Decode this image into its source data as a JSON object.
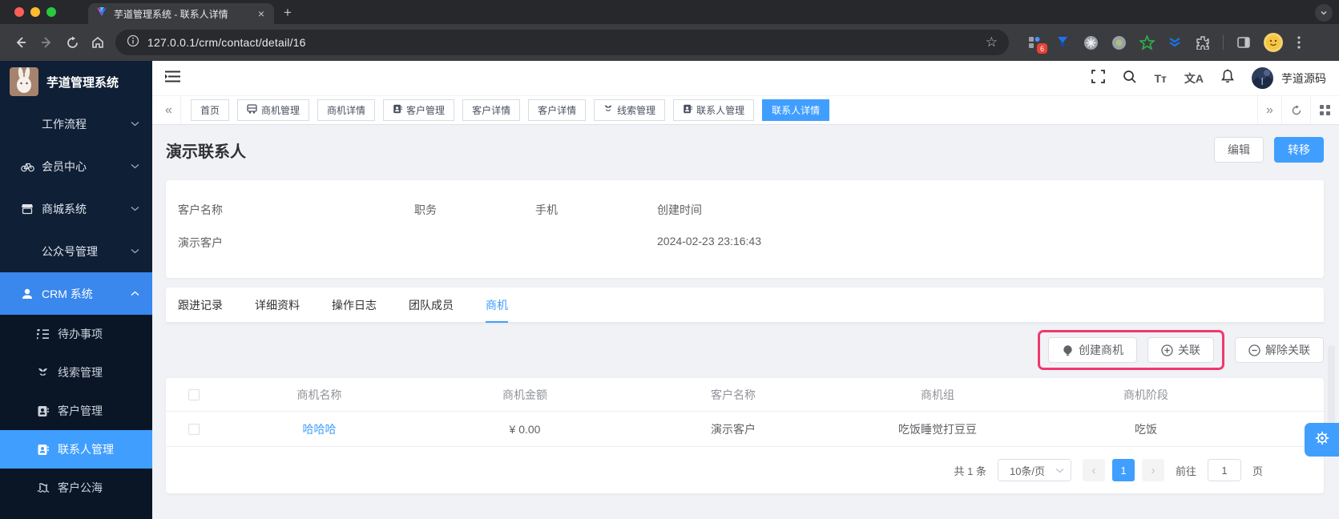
{
  "browser": {
    "tab_title": "芋道管理系统 - 联系人详情",
    "close_tab": "×",
    "new_tab": "+",
    "url": "127.0.0.1/crm/contact/detail/16",
    "bookmark_star": "☆",
    "extension_badge": "6"
  },
  "sidebar": {
    "app_title": "芋道管理系统",
    "root_items": [
      {
        "label": "工作流程"
      },
      {
        "label": "会员中心"
      },
      {
        "label": "商城系统"
      },
      {
        "label": "公众号管理"
      },
      {
        "label": "CRM 系统"
      }
    ],
    "crm_children": [
      {
        "label": "待办事项"
      },
      {
        "label": "线索管理"
      },
      {
        "label": "客户管理"
      },
      {
        "label": "联系人管理"
      },
      {
        "label": "客户公海"
      }
    ]
  },
  "header": {
    "font_icon": "Tт",
    "lang_icon": "文A",
    "username": "芋道源码"
  },
  "tags": {
    "back_arrow": "«",
    "forward_arrow": "»",
    "items": [
      {
        "label": "首页"
      },
      {
        "label": "商机管理"
      },
      {
        "label": "商机详情"
      },
      {
        "label": "客户管理"
      },
      {
        "label": "客户详情"
      },
      {
        "label": "客户详情"
      },
      {
        "label": "线索管理"
      },
      {
        "label": "联系人管理"
      },
      {
        "label": "联系人详情"
      }
    ]
  },
  "page": {
    "title": "演示联系人",
    "edit_label": "编辑",
    "transfer_label": "转移",
    "info": {
      "fields": [
        {
          "label": "客户名称",
          "value": "演示客户"
        },
        {
          "label": "职务",
          "value": ""
        },
        {
          "label": "手机",
          "value": ""
        },
        {
          "label": "创建时间",
          "value": "2024-02-23 23:16:43"
        }
      ]
    },
    "tabs": [
      {
        "label": "跟进记录"
      },
      {
        "label": "详细资料"
      },
      {
        "label": "操作日志"
      },
      {
        "label": "团队成员"
      },
      {
        "label": "商机"
      }
    ],
    "actions": {
      "create": "创建商机",
      "link": "关联",
      "unlink": "解除关联"
    },
    "table": {
      "headers": [
        "商机名称",
        "商机金额",
        "客户名称",
        "商机组",
        "商机阶段"
      ],
      "rows": [
        {
          "name": "哈哈哈",
          "amount": "¥ 0.00",
          "customer": "演示客户",
          "group": "吃饭睡觉打豆豆",
          "stage": "吃饭"
        }
      ]
    },
    "pagination": {
      "total": "共 1 条",
      "page_size": "10条/页",
      "prev": "‹",
      "current": "1",
      "next": "›",
      "goto_label": "前往",
      "goto_value": "1",
      "unit_label": "页"
    }
  },
  "colors": {
    "accent": "#409eff",
    "highlight_box": "#f1386e",
    "sidebar_bg": "#0f1f36",
    "sidebar_sub_bg": "#0a1626"
  }
}
